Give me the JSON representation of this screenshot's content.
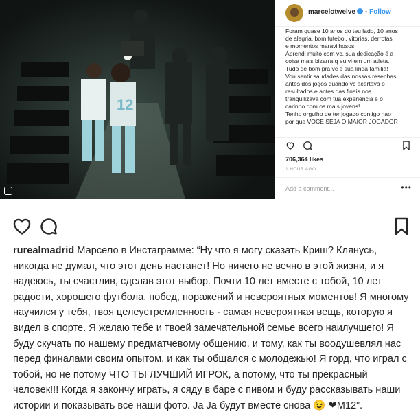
{
  "embedded_post": {
    "username": "marcelotwelve",
    "follow_label": "Follow",
    "caption": "Foram quase 10 anos do teu lado, 10 anos\nde alegria, bom futebol, vitorias, derrotas\ne momentos maravilhosos!\nAprendi muito com vc, sua dedicação é a\ncoisa mais bizarra q eu vi em um atleta.\nTudo de bom pra vc e sua linda familia!\nVou sentir saudades das nossas resenhas\nantes dos jogos quando vc acertava o\nresultados e antes das finais nos\ntranquilizava com tua experiência e o\ncarinho com os mais jovens!\nTenho orgulho de ter jogado contigo nao\npor que VOCE SEJA O MAIOR JOGADOR",
    "likes": "706,364 likes",
    "time_ago": "1 HOUR AGO",
    "comment_placeholder": "Add a comment...",
    "more_glyph": "•••"
  },
  "main_post": {
    "username": "rurealmadrid",
    "caption": "Марсело в Инстаграмме: “Ну что я могу сказать Криш? Клянусь, никогда не думал, что этот день настанет! Но ничего не вечно в этой жизни, и я надеюсь, ты счастлив, сделав этот выбор. Почти 10 лет вместе с тобой, 10 лет радости, хорошего футбола, побед, поражений и невероятных моментов! Я многому научился у тебя, твоя целеустремленность - самая невероятная вещь, которую я видел в спорте. Я желаю тебе и твоей замечательной семье всего наилучшего! Я буду скучать по нашему предматчевому общению, и тому, как ты воодушевлял нас перед финалами своим опытом, и как ты общался с молодежью! Я горд, что играл с тобой, но не потому ЧТО ТЫ ЛУЧШИЙ ИГРОК, а потому, что ты прекрасный человек!!! Когда я закончу играть, я сяду в баре с пивом и буду рассказывать наши истории и показывать все наши фото. Ja Ja будут вместе снова 😉 ❤M12”."
  },
  "icons": {
    "like": "heart-icon",
    "comment": "comment-icon",
    "save": "bookmark-icon"
  },
  "colors": {
    "link_blue": "#3897f0",
    "text": "#262626",
    "muted": "#8e8e8e"
  }
}
